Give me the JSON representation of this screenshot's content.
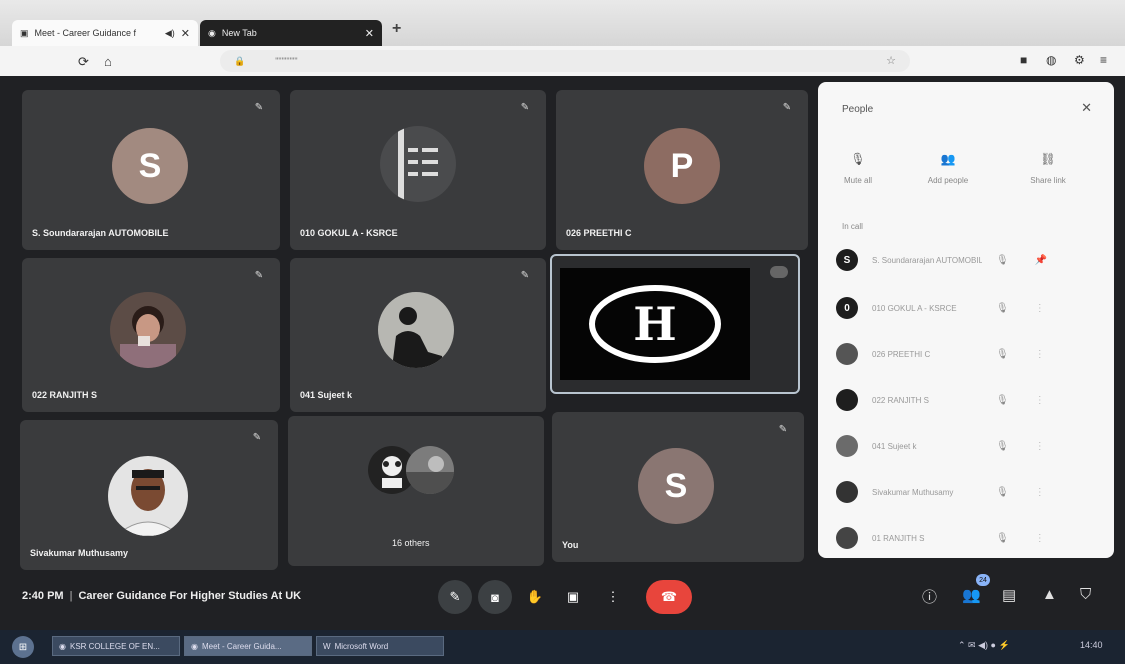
{
  "browser": {
    "tabs": [
      {
        "label": "Meet - Career Guidance f",
        "icon": "meet-icon",
        "active": true
      },
      {
        "label": "New Tab",
        "icon": "globe-icon",
        "active": false
      }
    ],
    "new_tab": "+",
    "url": "\"\"\"\"\"\"\"",
    "nav": {
      "reload": "⟳",
      "home": "⌂"
    }
  },
  "participants": [
    {
      "name": "S. Soundararajan AUTOMOBILE",
      "kind": "letter",
      "initial": "S",
      "color": "#a28a80"
    },
    {
      "name": "010 GOKUL A - KSRCE",
      "kind": "photo"
    },
    {
      "name": "026 PREETHI C",
      "kind": "letter",
      "initial": "P",
      "color": "#8d6c62"
    },
    {
      "name": "022 RANJITH S",
      "kind": "photo"
    },
    {
      "name": "041 Sujeet k",
      "kind": "photo"
    },
    {
      "name": "",
      "kind": "screen"
    },
    {
      "name": "Sivakumar Muthusamy",
      "kind": "photo"
    },
    {
      "name": "16 others",
      "kind": "group"
    },
    {
      "name": "You",
      "kind": "letter",
      "initial": "S",
      "color": "#8a7672"
    }
  ],
  "presentation_logo": "H",
  "people_panel": {
    "title": "People",
    "tabs": [
      "Mute all",
      "Add people",
      "Share link"
    ],
    "section": "In call",
    "rows": [
      {
        "initial": "S",
        "name": "S. Soundararajan AUTOMOBILE"
      },
      {
        "initial": "0",
        "name": "010 GOKUL A - KSRCE"
      },
      {
        "initial": "",
        "name": "026 PREETHI C"
      },
      {
        "initial": "",
        "name": "022 RANJITH S"
      },
      {
        "initial": "",
        "name": "041 Sujeet k"
      },
      {
        "initial": "",
        "name": "Sivakumar Muthusamy"
      },
      {
        "initial": "",
        "name": "01 RANJITH S"
      }
    ]
  },
  "meeting": {
    "time": "2:40 PM",
    "title": "Career Guidance For Higher Studies At UK",
    "participant_count": "24"
  },
  "taskbar": {
    "items": [
      "KSR COLLEGE OF EN...",
      "Meet - Career Guida...",
      "Microsoft Word"
    ],
    "clock": "14:40"
  },
  "colors": {
    "accent": "#8ab4f8",
    "end_call": "#e8453c",
    "tile_bg": "#3a3b3d"
  }
}
